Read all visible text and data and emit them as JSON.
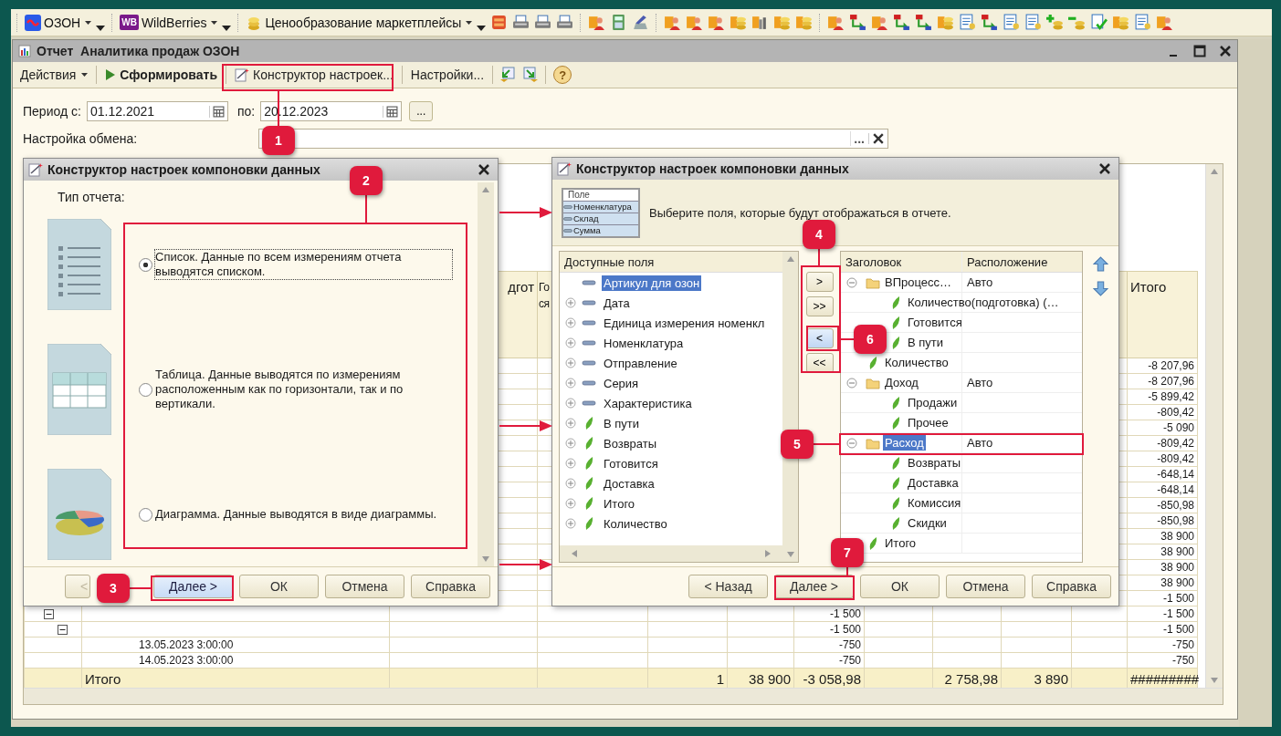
{
  "toolbar": {
    "menus": [
      {
        "label": "ОЗОН",
        "kind": "ozon"
      },
      {
        "label": "WildBerries",
        "kind": "wb",
        "logo_text": "WB"
      },
      {
        "label": "Ценообразование маркетплейсы",
        "kind": "coins"
      }
    ]
  },
  "report_window": {
    "title": "Отчет  Аналитика продаж ОЗОН",
    "commands": [
      {
        "kind": "menu",
        "label": "Действия"
      },
      {
        "kind": "run",
        "label": "Сформировать"
      },
      {
        "kind": "wizard",
        "label": "Конструктор настроек..."
      },
      {
        "kind": "plain",
        "label": "Настройки..."
      },
      {
        "kind": "import"
      },
      {
        "kind": "export"
      },
      {
        "kind": "help",
        "label": "?"
      }
    ],
    "period": {
      "label_from": "Период с:",
      "from": "01.12.2021",
      "label_to": "по:",
      "to": "20.12.2023",
      "more": "..."
    },
    "exchange": {
      "label": "Настройка обмена:",
      "more": "..."
    },
    "report_table": {
      "header": {
        "column_3": [
          "дгот"
        ],
        "column_4": [
          "Го",
          "ся"
        ],
        "column_12": [
          "Итого"
        ]
      },
      "rows": [
        {
          "column_12": "-8 207,96"
        },
        {
          "column_12": "-8 207,96"
        },
        {
          "column_12": "-5 899,42"
        },
        {
          "column_12": "-809,42"
        },
        {
          "column_12": "-5 090"
        },
        {
          "column_12": "-809,42"
        },
        {
          "column_12": "-809,42"
        },
        {
          "column_12": "-648,14"
        },
        {
          "column_12": "-648,14"
        },
        {
          "column_12": "-850,98"
        },
        {
          "column_12": "-850,98"
        },
        {
          "column_12": "38 900"
        },
        {
          "column_12": "38 900"
        },
        {
          "column_12": "38 900"
        },
        {
          "column_12": "38 900"
        },
        {
          "column_12": "-1 500"
        },
        {
          "expanded": true,
          "column_7": "-1 500",
          "column_12": "-1 500"
        },
        {
          "expanded": true,
          "column_7": "-1 500",
          "column_12": "-1 500"
        },
        {
          "column_2": "13.05.2023 3:00:00",
          "column_7": "-750",
          "column_12": "-750"
        },
        {
          "column_2": "14.05.2023 3:00:00",
          "column_7": "-750",
          "column_12": "-750"
        }
      ],
      "total_row": {
        "column_2": "Итого",
        "column_5": "1",
        "column_6": "38 900",
        "column_7": "-3 058,98",
        "column_9": "2 758,98",
        "column_10": "3 890",
        "column_12": "#########"
      }
    }
  },
  "type_dialog": {
    "title": "Конструктор настроек компоновки данных",
    "prompt": "Тип отчета:",
    "report_types": [
      {
        "kind": "list",
        "label": "Список. Данные по всем измерениям отчета выводятся списком.",
        "selected": true
      },
      {
        "kind": "table",
        "label": "Таблица. Данные выводятся по измерениям расположенным как по горизонтали, так и по вертикали.",
        "selected": false
      },
      {
        "kind": "chart",
        "label": "Диаграмма. Данные выводятся в виде диаграммы.",
        "selected": false
      }
    ],
    "buttons": [
      {
        "label": "<",
        "disabled": true,
        "focused": false
      },
      {
        "label": "Далее >",
        "disabled": false,
        "focused": true
      },
      {
        "label": "ОК",
        "disabled": false,
        "focused": false
      },
      {
        "label": "Отмена",
        "disabled": false,
        "focused": false
      },
      {
        "label": "Справка",
        "disabled": false,
        "focused": false
      }
    ]
  },
  "fields_dialog": {
    "title": "Конструктор настроек компоновки данных",
    "preview": {
      "header": "Поле",
      "fields": [
        "Номенклатура",
        "Склад",
        "Сумма"
      ]
    },
    "description": "Выберите поля, которые будут отображаться в отчете.",
    "available_header": "Доступные поля",
    "available_fields": [
      {
        "label": "Артикул для озон",
        "kind": "dimension",
        "expandable": false,
        "selected": true
      },
      {
        "label": "Дата",
        "kind": "dimension",
        "expandable": true,
        "selected": false
      },
      {
        "label": "Единица измерения номенкл",
        "kind": "dimension",
        "expandable": true,
        "selected": false
      },
      {
        "label": "Номенклатура",
        "kind": "dimension",
        "expandable": true,
        "selected": false
      },
      {
        "label": "Отправление",
        "kind": "dimension",
        "expandable": true,
        "selected": false
      },
      {
        "label": "Серия",
        "kind": "dimension",
        "expandable": true,
        "selected": false
      },
      {
        "label": "Характеристика",
        "kind": "dimension",
        "expandable": true,
        "selected": false
      },
      {
        "label": "В пути",
        "kind": "resource",
        "expandable": true,
        "selected": false
      },
      {
        "label": "Возвраты",
        "kind": "resource",
        "expandable": true,
        "selected": false
      },
      {
        "label": "Готовится",
        "kind": "resource",
        "expandable": true,
        "selected": false
      },
      {
        "label": "Доставка",
        "kind": "resource",
        "expandable": true,
        "selected": false
      },
      {
        "label": "Итого",
        "kind": "resource",
        "expandable": true,
        "selected": false
      },
      {
        "label": "Количество",
        "kind": "resource",
        "expandable": true,
        "selected": false
      }
    ],
    "move_buttons": [
      {
        "label": ">",
        "selected": false
      },
      {
        "label": ">>",
        "selected": false
      },
      {
        "label": "<",
        "selected": true
      },
      {
        "label": "<<",
        "selected": false
      }
    ],
    "selected_columns": [
      "Заголовок",
      "Расположение"
    ],
    "selected_fields": [
      {
        "title": "ВПроцесс…",
        "placement": "Авто",
        "kind": "folder",
        "expanded": true,
        "selected": false,
        "children": [
          {
            "title": "Количество(подготовка) (…",
            "kind": "field",
            "selected": false
          },
          {
            "title": "Готовится",
            "kind": "field",
            "selected": false
          },
          {
            "title": "В пути",
            "kind": "field",
            "selected": false
          }
        ]
      },
      {
        "title": "Количество",
        "kind": "field",
        "selected": false
      },
      {
        "title": "Доход",
        "placement": "Авто",
        "kind": "folder",
        "expanded": true,
        "selected": false,
        "children": [
          {
            "title": "Продажи",
            "kind": "field",
            "selected": false
          },
          {
            "title": "Прочее",
            "kind": "field",
            "selected": false
          }
        ]
      },
      {
        "title": "Расход",
        "placement": "Авто",
        "kind": "folder",
        "expanded": true,
        "selected": true,
        "children": [
          {
            "title": "Возвраты",
            "kind": "field",
            "selected": false
          },
          {
            "title": "Доставка",
            "kind": "field",
            "selected": false
          },
          {
            "title": "Комиссия",
            "kind": "field",
            "selected": false
          },
          {
            "title": "Скидки",
            "kind": "field",
            "selected": false
          }
        ]
      },
      {
        "title": "Итого",
        "kind": "field",
        "selected": false
      }
    ],
    "buttons": [
      {
        "label": "< Назад",
        "disabled": false,
        "focused": false
      },
      {
        "label": "Далее >",
        "disabled": false,
        "focused": false
      },
      {
        "label": "ОК",
        "disabled": false,
        "focused": false
      },
      {
        "label": "Отмена",
        "disabled": false,
        "focused": false
      },
      {
        "label": "Справка",
        "disabled": false,
        "focused": false
      }
    ]
  },
  "callouts": [
    {
      "number": "1"
    },
    {
      "number": "2"
    },
    {
      "number": "3"
    },
    {
      "number": "4"
    },
    {
      "number": "5"
    },
    {
      "number": "6"
    },
    {
      "number": "7"
    }
  ]
}
